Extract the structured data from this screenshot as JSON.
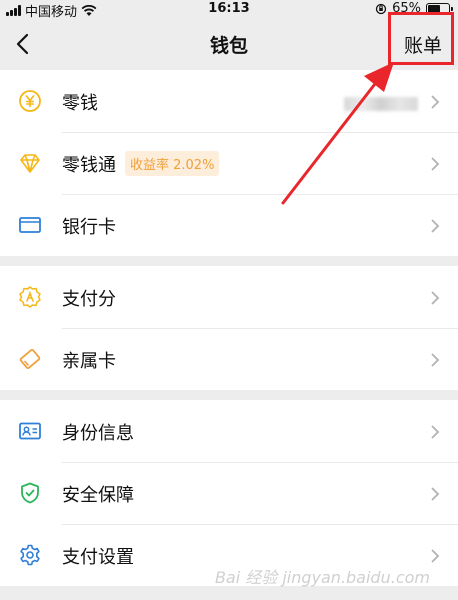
{
  "status_bar": {
    "carrier": "中国移动",
    "time": "16:13",
    "battery": "65%"
  },
  "nav": {
    "title": "钱包",
    "bill_button": "账单"
  },
  "groups": [
    {
      "items": [
        {
          "label": "零钱",
          "icon": "yen-coin-icon",
          "value_blurred": true
        },
        {
          "label": "零钱通",
          "icon": "diamond-icon",
          "badge": "收益率 2.02%"
        },
        {
          "label": "银行卡",
          "icon": "bank-card-icon"
        }
      ]
    },
    {
      "items": [
        {
          "label": "支付分",
          "icon": "pay-score-icon"
        },
        {
          "label": "亲属卡",
          "icon": "family-card-icon"
        }
      ]
    },
    {
      "items": [
        {
          "label": "身份信息",
          "icon": "id-card-icon"
        },
        {
          "label": "安全保障",
          "icon": "shield-icon"
        },
        {
          "label": "支付设置",
          "icon": "gear-icon"
        }
      ]
    }
  ],
  "watermark": "Bai 经验 jingyan.baidu.com",
  "colors": {
    "accent_yellow": "#f5b716",
    "accent_orange": "#f0a03c",
    "accent_blue": "#2f7fd9",
    "accent_green": "#2bb55b",
    "annotation_red": "#e8262b",
    "background": "#ededed"
  }
}
